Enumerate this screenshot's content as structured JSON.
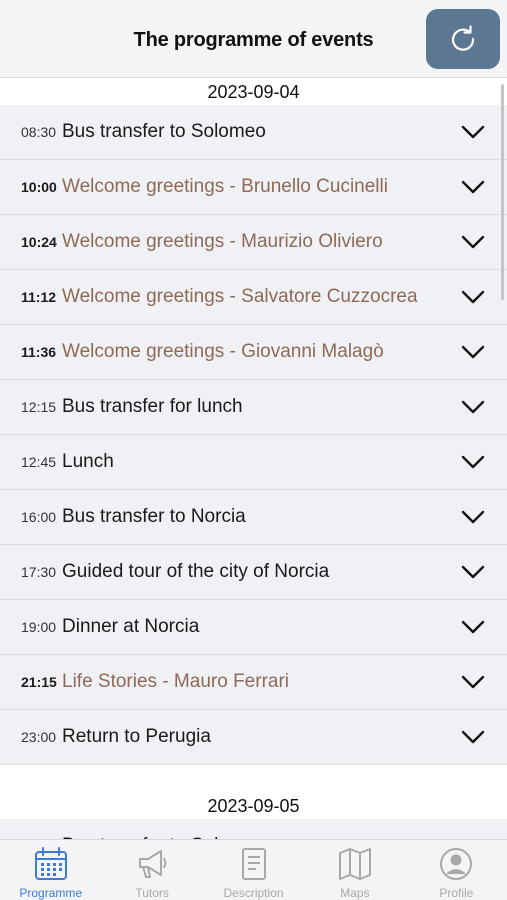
{
  "header": {
    "title": "The programme of events",
    "refresh_icon": "refresh-icon"
  },
  "days": [
    {
      "date": "2023-09-04",
      "events": [
        {
          "time": "08:30",
          "title": "Bus transfer to Solomeo",
          "highlight": false
        },
        {
          "time": "10:00",
          "title": "Welcome greetings - Brunello Cucinelli",
          "highlight": true
        },
        {
          "time": "10:24",
          "title": "Welcome greetings - Maurizio Oliviero",
          "highlight": true
        },
        {
          "time": "11:12",
          "title": "Welcome greetings - Salvatore Cuzzocrea",
          "highlight": true
        },
        {
          "time": "11:36",
          "title": "Welcome greetings - Giovanni Malagò",
          "highlight": true
        },
        {
          "time": "12:15",
          "title": "Bus transfer for lunch",
          "highlight": false
        },
        {
          "time": "12:45",
          "title": "Lunch",
          "highlight": false
        },
        {
          "time": "16:00",
          "title": "Bus transfer to Norcia",
          "highlight": false
        },
        {
          "time": "17:30",
          "title": "Guided tour of the city of Norcia",
          "highlight": false
        },
        {
          "time": "19:00",
          "title": "Dinner at Norcia",
          "highlight": false
        },
        {
          "time": "21:15",
          "title": "Life Stories - Mauro Ferrari",
          "highlight": true
        },
        {
          "time": "23:00",
          "title": "Return to Perugia",
          "highlight": false
        }
      ]
    },
    {
      "date": "2023-09-05",
      "events": [
        {
          "time": "",
          "title": "Bus transfer to Solomeo",
          "highlight": false
        }
      ]
    }
  ],
  "tabs": [
    {
      "label": "Programme",
      "icon": "calendar-icon",
      "active": true
    },
    {
      "label": "Tutors",
      "icon": "megaphone-icon",
      "active": false
    },
    {
      "label": "Description",
      "icon": "document-icon",
      "active": false
    },
    {
      "label": "Maps",
      "icon": "map-icon",
      "active": false
    },
    {
      "label": "Profile",
      "icon": "profile-icon",
      "active": false
    }
  ],
  "colors": {
    "accent": "#3d7bd8",
    "highlight_text": "#8e6a55",
    "refresh_button": "#5c7792",
    "inactive": "#a8a8a8"
  }
}
